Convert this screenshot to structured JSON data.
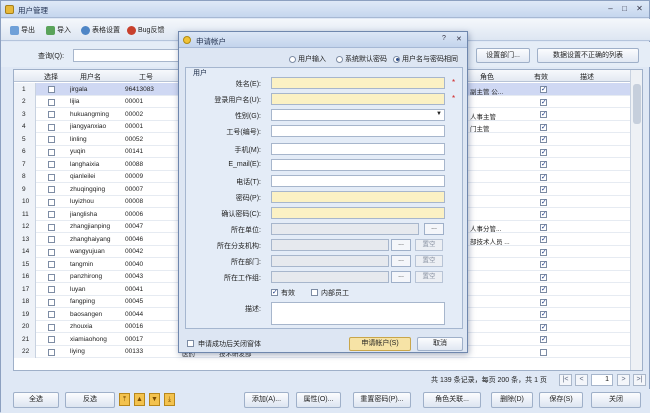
{
  "window": {
    "title": "用户管理",
    "controls": [
      "–",
      "□",
      "✕"
    ]
  },
  "toolbar": {
    "export": "导出",
    "import": "导入",
    "table_settings": "表格设置",
    "bug_report": "Bug反馈"
  },
  "search": {
    "label": "查询(Q):",
    "value": "",
    "btn_settings_dept": "设置部门...",
    "btn_bad_data": "数据设置不正确的列表"
  },
  "grid": {
    "headers": {
      "select": "选择",
      "username": "用户名",
      "empno": "工号",
      "role": "角色",
      "valid": "有效",
      "desc": "描述"
    },
    "rows": [
      {
        "n": "1",
        "user": "jirgala",
        "no": "96413083",
        "role": "副主管 公...",
        "valid": true,
        "selected": true
      },
      {
        "n": "2",
        "user": "lijia",
        "no": "00001",
        "role": "",
        "valid": true
      },
      {
        "n": "3",
        "user": "hukuangming",
        "no": "00002",
        "role": "人事主管",
        "valid": true
      },
      {
        "n": "4",
        "user": "jiangyanxiao",
        "no": "00001",
        "role": "门主管",
        "valid": true
      },
      {
        "n": "5",
        "user": "linling",
        "no": "00052",
        "role": "",
        "valid": true
      },
      {
        "n": "6",
        "user": "yuqin",
        "no": "00141",
        "role": "",
        "valid": true
      },
      {
        "n": "7",
        "user": "langhaixia",
        "no": "00088",
        "role": "",
        "valid": true
      },
      {
        "n": "8",
        "user": "qianleilei",
        "no": "00009",
        "role": "",
        "valid": true
      },
      {
        "n": "9",
        "user": "zhuqingqing",
        "no": "00007",
        "role": "",
        "valid": true
      },
      {
        "n": "10",
        "user": "luyizhou",
        "no": "00008",
        "role": "",
        "valid": true
      },
      {
        "n": "11",
        "user": "jianglisha",
        "no": "00006",
        "role": "",
        "valid": true
      },
      {
        "n": "12",
        "user": "zhangjianping",
        "no": "00047",
        "role": "人事分管...",
        "valid": true
      },
      {
        "n": "13",
        "user": "zhanghaiyang",
        "no": "00046",
        "role": "部技术人员 ...",
        "valid": true
      },
      {
        "n": "14",
        "user": "wangyujuan",
        "no": "00042",
        "role": "",
        "valid": true
      },
      {
        "n": "15",
        "user": "tangmin",
        "no": "00040",
        "role": "",
        "valid": true
      },
      {
        "n": "16",
        "user": "panzhirong",
        "no": "00043",
        "role": "",
        "valid": true
      },
      {
        "n": "17",
        "user": "luyan",
        "no": "00041",
        "role": "",
        "valid": true
      },
      {
        "n": "18",
        "user": "fangping",
        "no": "00045",
        "role": "",
        "valid": true
      },
      {
        "n": "19",
        "user": "baosangen",
        "no": "00044",
        "role": "",
        "valid": true
      },
      {
        "n": "20",
        "user": "zhouxia",
        "no": "00016",
        "role": "",
        "valid": true
      },
      {
        "n": "21",
        "user": "xiamiaohong",
        "no": "00017",
        "role": "",
        "valid": true
      },
      {
        "n": "22",
        "user": "liying",
        "no": "00133",
        "role": "",
        "valid": false,
        "extra1": "医药",
        "extra2": "技术研发部"
      }
    ]
  },
  "pager": {
    "summary": "共 139 条记录，每页 200 条，共 1 页",
    "page": "1"
  },
  "bottom": {
    "select_all": "全选",
    "invert": "反选",
    "add": "添加(A)...",
    "props": "属性(O)...",
    "reset_pwd": "重置密码(P)...",
    "role_link": "角色关联...",
    "delete": "删除(D)",
    "save": "保存(S)",
    "close": "关闭"
  },
  "dialog": {
    "title": "申请帐户",
    "help": "?",
    "close": "✕",
    "radio_user_input": "用户输入",
    "radio_default_pwd": "系统默认密码",
    "radio_same_pwd": "用户名与密码相同",
    "group_title": "用户",
    "fields": {
      "name": "姓名(E):",
      "login": "登录用户名(U):",
      "gender": "性别(G):",
      "empno": "工号(编号):",
      "mobile": "手机(M):",
      "email": "E_mail(E):",
      "phone": "电话(T):",
      "password": "密码(P):",
      "confirm": "确认密码(C):",
      "company": "所在单位:",
      "branch": "所在分支机构:",
      "dept": "所在部门:",
      "workgroup": "所在工作组:",
      "desc": "描述:"
    },
    "dots": "...",
    "clear": "置空",
    "valid": "有效",
    "internal": "内部员工",
    "close_after": "申请成功后关闭窗体",
    "apply": "申请帐户(S)",
    "cancel": "取消"
  }
}
